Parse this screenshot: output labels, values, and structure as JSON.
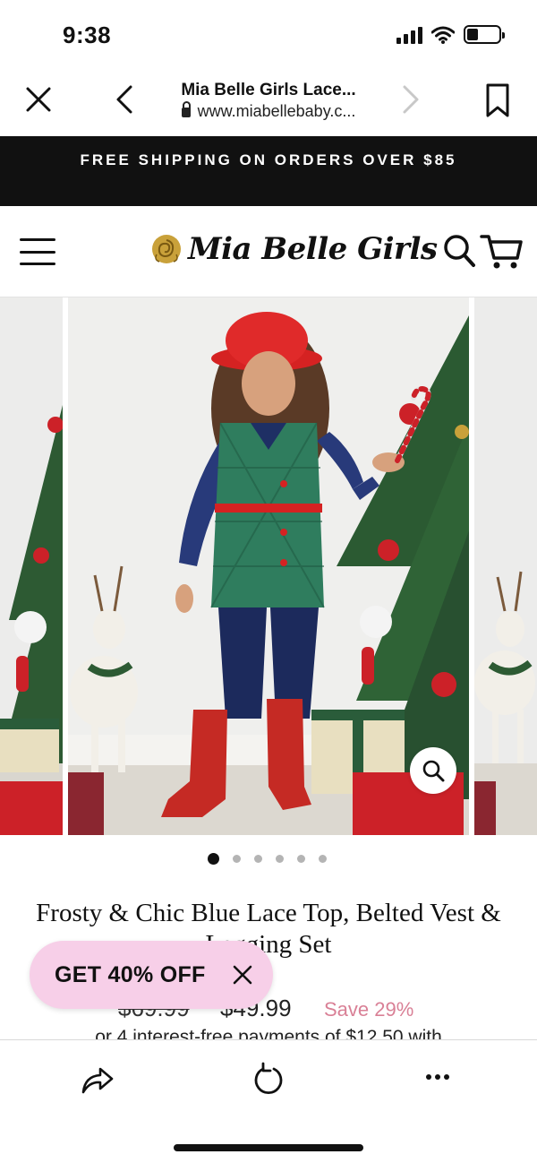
{
  "status_bar": {
    "time": "9:38",
    "battery_level": 0.35
  },
  "browser": {
    "title": "Mia Belle Girls Lace...",
    "url": "www.miabellebaby.c...",
    "icons": [
      "close-icon",
      "back-icon",
      "forward-icon",
      "bookmark-icon",
      "lock-icon"
    ]
  },
  "promo": {
    "text": "FREE SHIPPING ON ORDERS OVER $85"
  },
  "header": {
    "logo_text": "Mia Belle Girls",
    "icons": [
      "hamburger-icon",
      "rose-logo-icon",
      "search-icon",
      "cart-icon"
    ]
  },
  "gallery": {
    "slide_count": 6,
    "active_slide": 1,
    "icons": [
      "zoom-icon"
    ]
  },
  "product": {
    "title": "Frosty & Chic Blue Lace Top, Belted Vest & Legging Set",
    "old_price": "$69.99",
    "new_price": "$49.99",
    "save_text": "Save 29%",
    "installments_text": "or 4 interest-free payments of $12.50 with"
  },
  "discount_popup": {
    "label": "GET 40% OFF"
  },
  "toolbar": {
    "icons": [
      "share-icon",
      "reload-icon",
      "more-icon"
    ]
  },
  "colors": {
    "banner": "#111111",
    "pill": "#f7cfe8",
    "save": "#d98096",
    "vest": "#2f7d5e",
    "hat": "#e02a2a"
  }
}
